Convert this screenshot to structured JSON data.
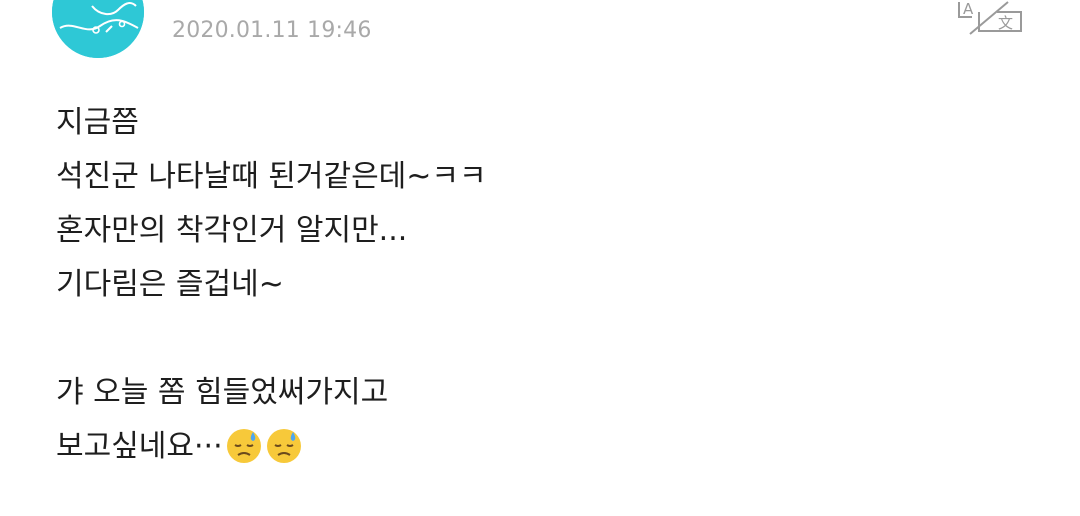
{
  "post": {
    "author_name": "· · · ·",
    "timestamp": "2020.01.11 19:46",
    "translate_icon": "translate-icon",
    "lines": [
      "지금쯤",
      "석진군 나타날때 된거같은데~ㅋㅋ",
      "혼자만의 착각인거 알지만...",
      "기다림은 즐겁네~",
      "",
      "갸 오늘 쫌 힘들었써가지고",
      "보고싶네요···"
    ],
    "trailing_emoji": [
      "downcast-face-with-sweat",
      "downcast-face-with-sweat"
    ]
  },
  "colors": {
    "avatar": "#2ec8d6",
    "timestamp": "#a9a9a9",
    "text": "#1e1e1e",
    "icon": "#9a9a9a"
  }
}
